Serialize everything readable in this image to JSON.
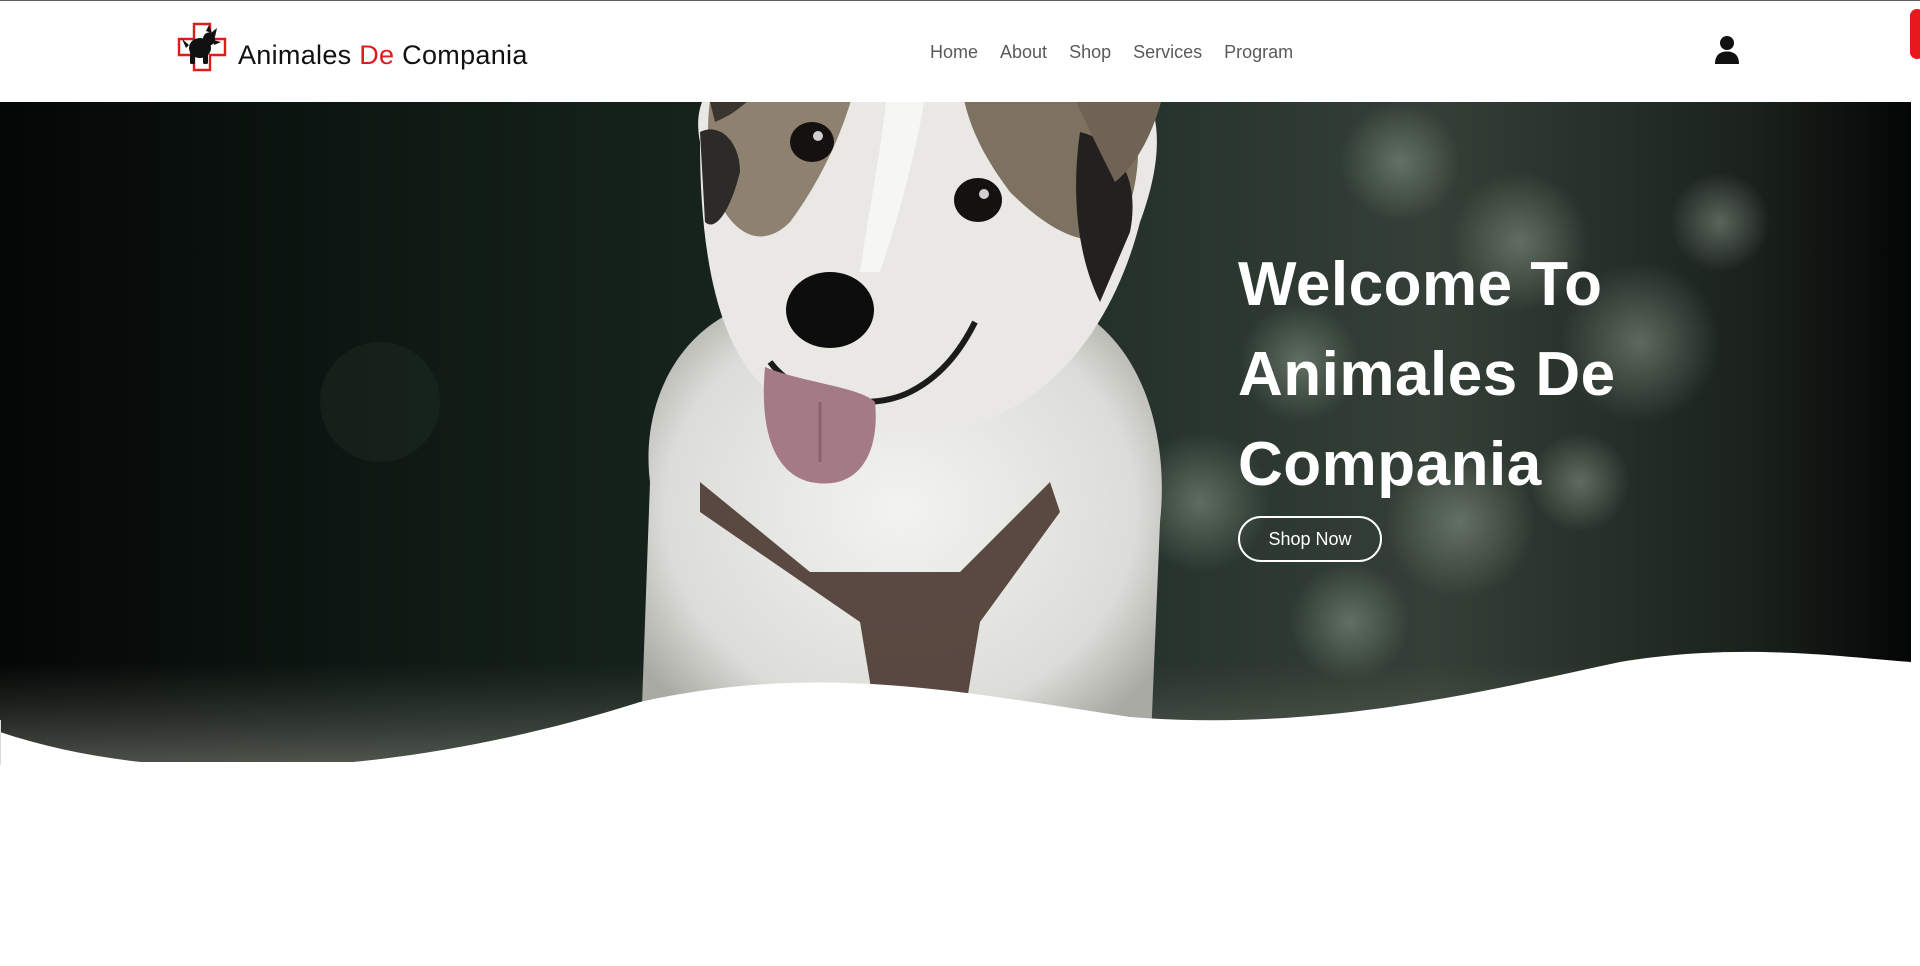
{
  "brand": {
    "name_part1": "Animales ",
    "name_accent": "De",
    "name_part2": " Compania",
    "accent_color": "#e01b1b",
    "logo_icon": "dog-in-red-cross-icon"
  },
  "nav": {
    "items": [
      {
        "label": "Home"
      },
      {
        "label": "About"
      },
      {
        "label": "Shop"
      },
      {
        "label": "Services"
      },
      {
        "label": "Program"
      }
    ]
  },
  "header": {
    "user_icon": "user-icon"
  },
  "hero": {
    "title_lines": [
      "Welcome To",
      "Animales De",
      "Compania"
    ],
    "cta_label": "Shop Now",
    "image": "corgi-dog-photo"
  },
  "colors": {
    "scroll_indicator": "#e8191c",
    "hero_text": "#ffffff",
    "nav_text": "#5a5a5a"
  }
}
